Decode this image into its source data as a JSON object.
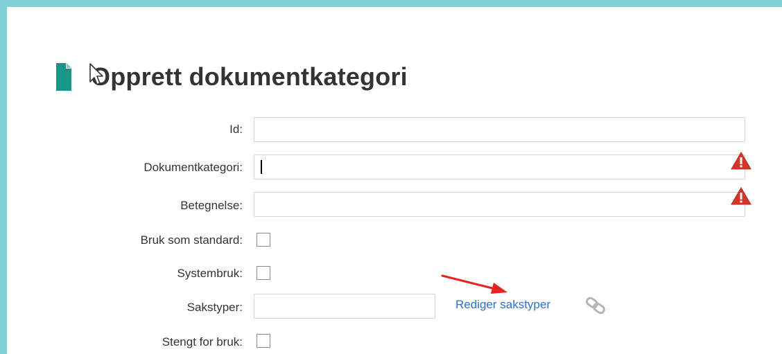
{
  "page": {
    "title": "Opprett dokumentkategori"
  },
  "form": {
    "id_label": "Id:",
    "id_value": "",
    "dokumentkategori_label": "Dokumentkategori:",
    "dokumentkategori_value": "",
    "betegnelse_label": "Betegnelse:",
    "betegnelse_value": "",
    "bruk_som_standard_label": "Bruk som standard:",
    "systembruk_label": "Systembruk:",
    "sakstyper_label": "Sakstyper:",
    "sakstyper_value": "",
    "stengt_for_bruk_label": "Stengt for bruk:",
    "rediger_sakstyper_link": "Rediger sakstyper"
  },
  "colors": {
    "frame_border": "#7fd0d6",
    "doc_icon": "#1a9688",
    "link": "#2a72c8",
    "warning": "#d9342b",
    "annotation_arrow": "#e8231f"
  },
  "icons": {
    "title_icon": "document-icon",
    "cursor": "mouse-pointer-icon",
    "validation": "warning-triangle-icon",
    "link_icon": "chain-link-icon",
    "annotation": "red-arrow-annotation"
  }
}
